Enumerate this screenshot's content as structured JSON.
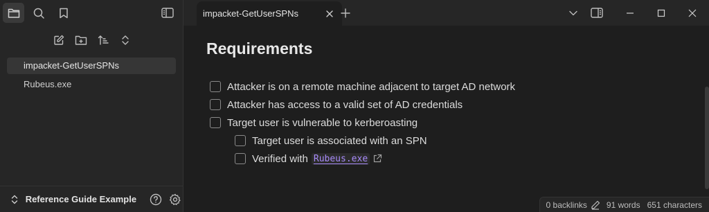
{
  "sidebar": {
    "ribbon": [
      {
        "icon": "folder-icon",
        "active": true
      },
      {
        "icon": "search-icon",
        "active": false
      },
      {
        "icon": "bookmark-icon",
        "active": false
      }
    ],
    "nav_actions": [
      "new-note-icon",
      "new-folder-icon",
      "sort-icon",
      "collapse-expand-icon"
    ],
    "files": [
      {
        "label": "impacket-GetUserSPNs",
        "active": true
      },
      {
        "label": "Rubeus.exe",
        "active": false
      }
    ],
    "vault_name": "Reference Guide Example"
  },
  "tabs": [
    {
      "title": "impacket-GetUserSPNs",
      "active": true
    }
  ],
  "editor": {
    "heading": "Requirements",
    "tasks": [
      {
        "text": "Attacker is on a remote machine adjacent to target AD network",
        "checked": false,
        "level": 0
      },
      {
        "text": "Attacker has access to a valid set of AD credentials",
        "checked": false,
        "level": 0
      },
      {
        "text": "Target user is vulnerable to kerberoasting",
        "checked": false,
        "level": 0
      },
      {
        "text": "Target user is associated with an SPN",
        "checked": false,
        "level": 1
      },
      {
        "text": "Verified with",
        "link": "Rubeus.exe",
        "checked": false,
        "level": 1
      }
    ]
  },
  "status": {
    "backlinks": "0 backlinks",
    "words": "91 words",
    "characters": "651 characters"
  },
  "colors": {
    "sidebar_bg": "#262626",
    "editor_bg": "#1e1e1e",
    "link": "#a88bfa"
  }
}
